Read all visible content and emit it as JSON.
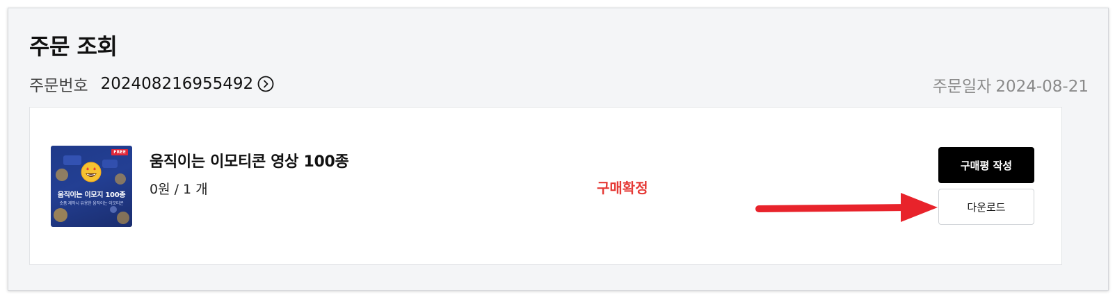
{
  "page": {
    "title": "주문 조회"
  },
  "order": {
    "number_label": "주문번호",
    "number": "202408216955492",
    "date_label": "주문일자",
    "date": "2024-08-21"
  },
  "item": {
    "thumbnail": {
      "badge": "FREE",
      "title": "움직이는 이모지 100종",
      "subtitle": "숏폼 제작시 유용한 움직이는 이모티콘"
    },
    "name": "움직이는 이모티콘 영상 100종",
    "price_qty": "0원 / 1 개",
    "status": "구매확정",
    "status_color": "#e53935"
  },
  "actions": {
    "review_label": "구매평 작성",
    "download_label": "다운로드"
  },
  "icons": {
    "order_link": "chevron-right-circle-icon",
    "annotation": "red-arrow-icon"
  },
  "colors": {
    "panel_bg": "#f4f5f7",
    "primary_button": "#000000",
    "annotation_arrow": "#e8232b"
  }
}
